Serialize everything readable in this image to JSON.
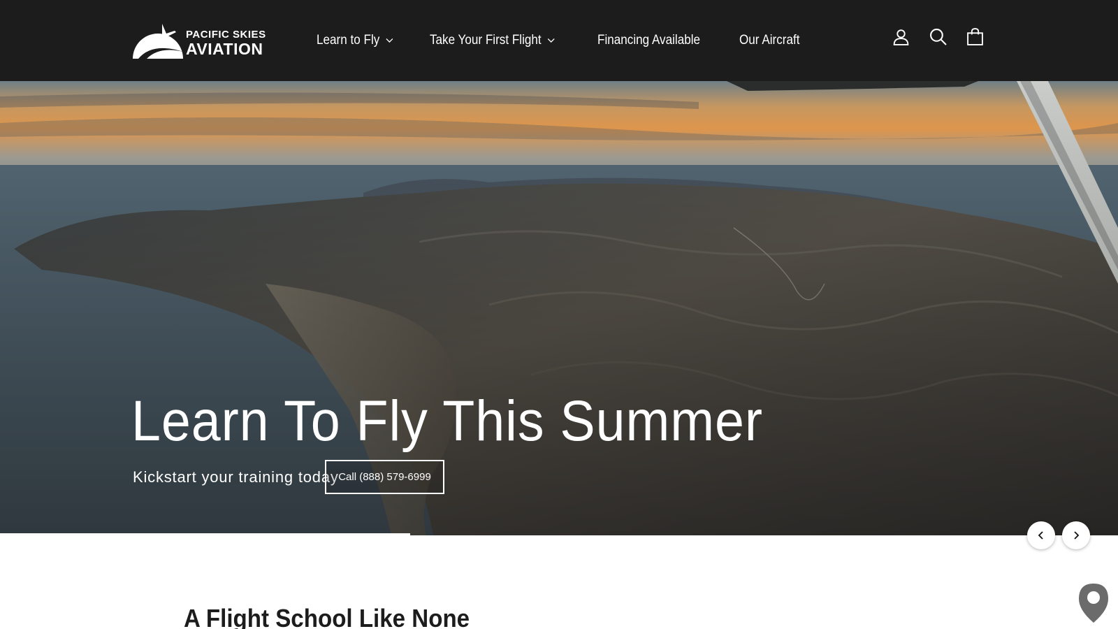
{
  "header": {
    "logo": {
      "line1": "PACIFIC SKIES",
      "line2": "AVIATION"
    },
    "nav": [
      {
        "label": "Learn to Fly",
        "has_dropdown": true
      },
      {
        "label": "Take Your First Flight",
        "has_dropdown": true
      },
      {
        "label": "Financing Available",
        "has_dropdown": false
      },
      {
        "label": "Our Aircraft",
        "has_dropdown": false
      }
    ],
    "icons": [
      "account-icon",
      "search-icon",
      "cart-icon"
    ]
  },
  "hero": {
    "title": "Learn To Fly This Summer",
    "subtitle": "Kickstart your training today",
    "cta_label": "Call (888) 579-6999"
  },
  "slider": {
    "prev_icon": "chevron-left-icon",
    "next_icon": "chevron-right-icon"
  },
  "intro": {
    "heading": "A Flight School Like None"
  },
  "colors": {
    "header_bg": "#1c1c1c",
    "text_light": "#ffffff",
    "text_dark": "#1c1c1c"
  }
}
